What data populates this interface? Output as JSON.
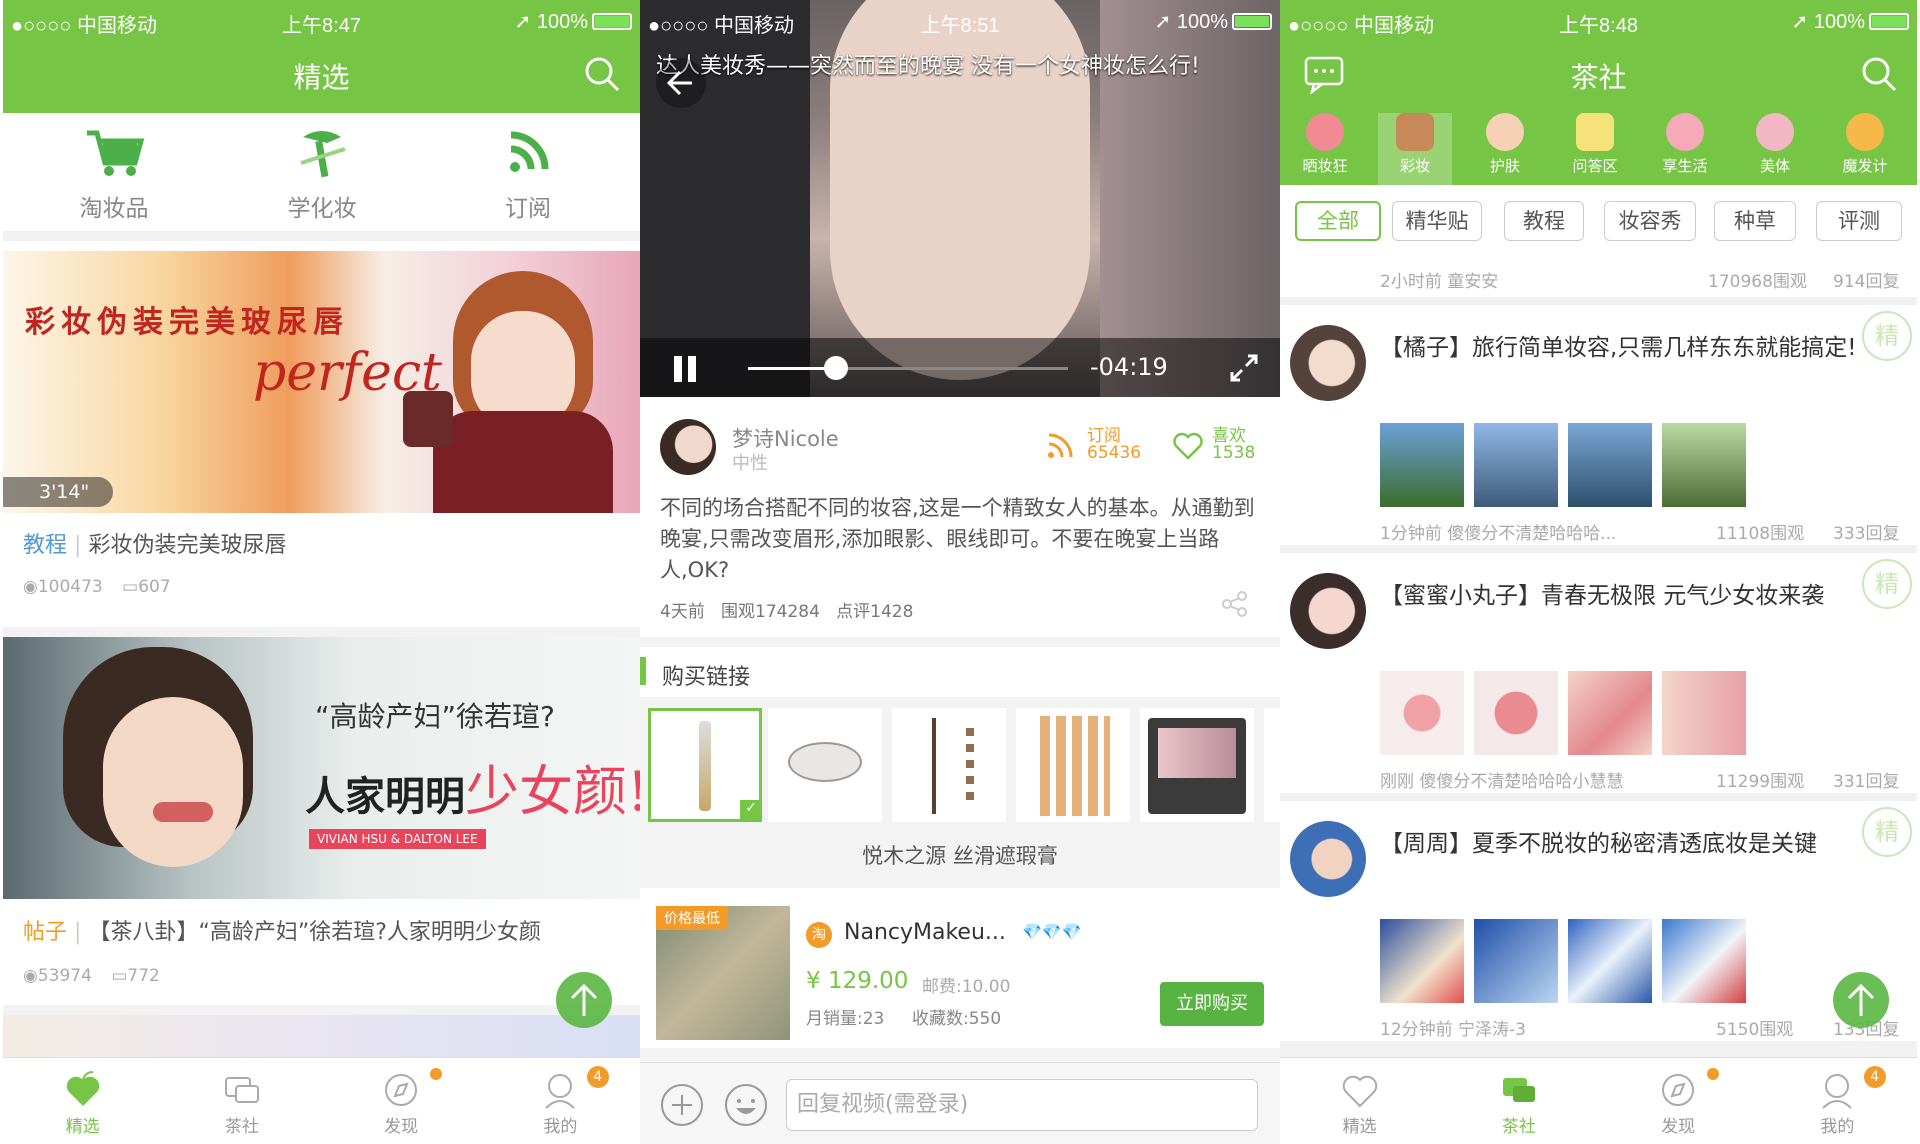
{
  "colors": {
    "accent": "#77c545",
    "orange": "#f39b29"
  },
  "status": {
    "carrier": "●○○○○ 中国移动",
    "battery": "100%",
    "time1": "上午8:47",
    "time2": "上午8:51",
    "time3": "上午8:48"
  },
  "p1": {
    "title": "精选",
    "quick": [
      {
        "label": "淘妆品",
        "icon": "cart-icon"
      },
      {
        "label": "学化妆",
        "icon": "makeup-brush-icon"
      },
      {
        "label": "订阅",
        "icon": "rss-icon"
      }
    ],
    "card1": {
      "banner_title": "彩妆伪装完美玻尿唇",
      "banner_script": "perfect",
      "duration": "3'14\"",
      "tag": "教程",
      "sep": "|",
      "title": "彩妆伪装完美玻尿唇",
      "views": "100473",
      "comments": "607"
    },
    "card2": {
      "line1": "“高龄产妇”徐若瑄?",
      "line2a": "人家明明",
      "line2b": "少女颜!",
      "names": "VIVIAN HSU & DALTON LEE",
      "tag": "帖子",
      "sep": "|",
      "title": "【茶八卦】“高龄产妇”徐若瑄?人家明明少女颜",
      "views": "53974",
      "comments": "772"
    }
  },
  "p2": {
    "video_title": "达人美妆秀——突然而至的晚宴 没有一个女神妆怎么行!",
    "time_left": "-04:19",
    "author": "梦诗Nicole",
    "gender": "中性",
    "subscribe_label": "订阅",
    "subscribe_count": "65436",
    "like_label": "喜欢",
    "like_count": "1538",
    "desc": "不同的场合搭配不同的妆容,这是一个精致女人的基本。从通勤到晚宴,只需改变眉形,添加眼影、眼线即可。不要在晚宴上当路人,OK?",
    "time_ago": "4天前",
    "views": "围观174284",
    "comments": "点评1428",
    "buy_section": "购买链接",
    "product_name": "悦木之源 丝滑遮瑕膏",
    "shop": {
      "tag": "价格最低",
      "platform": "淘",
      "name": "NancyMakeu...",
      "diamonds": "💎💎💎",
      "price": "¥ 129.00",
      "shipping": "邮费:10.00",
      "sales": "月销量:23",
      "fav": "收藏数:550",
      "buy": "立即购买"
    },
    "reply_placeholder": "回复视频(需登录)"
  },
  "p3": {
    "title": "茶社",
    "cats": [
      "晒妆狂",
      "彩妆",
      "护肤",
      "问答区",
      "享生活",
      "美体",
      "魔发计"
    ],
    "filters": [
      "全部",
      "精华贴",
      "教程",
      "妆容秀",
      "种草",
      "评测"
    ],
    "top_meta": {
      "left": "2小时前 童安安",
      "views": "170968围观",
      "replies": "914回复"
    },
    "posts": [
      {
        "title": "【橘子】旅行简单妆容,只需几样东东就能搞定!",
        "meta": "1分钟前 傻傻分不清楚哈哈哈...",
        "views": "11108围观",
        "replies": "333回复",
        "badge": "精"
      },
      {
        "title": "【蜜蜜小丸子】青春无极限 元气少女妆来袭",
        "meta": "刚刚 傻傻分不清楚哈哈哈小慧慧",
        "views": "11299围观",
        "replies": "331回复",
        "badge": "精"
      },
      {
        "title": "【周周】夏季不脱妆的秘密清透底妆是关键",
        "meta": "12分钟前 宁泽涛-3",
        "views": "5150围观",
        "replies": "133回复",
        "badge": "精"
      }
    ]
  },
  "tabs": [
    "精选",
    "茶社",
    "发现",
    "我的"
  ],
  "badge_count": "4"
}
